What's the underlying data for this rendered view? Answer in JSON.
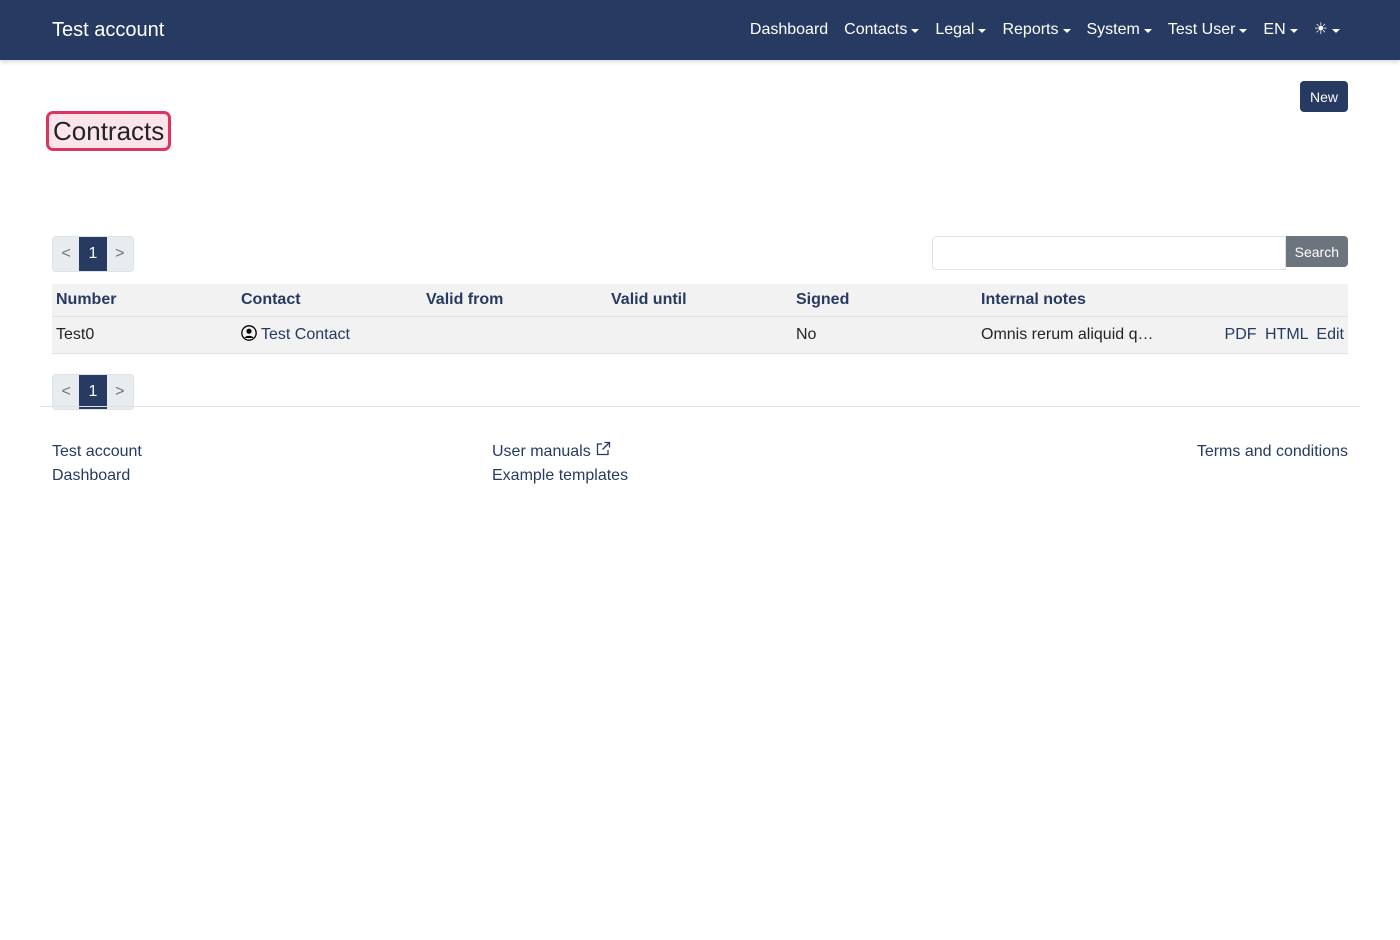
{
  "navbar": {
    "brand": "Test account",
    "items": [
      {
        "label": "Dashboard"
      },
      {
        "label": "Contacts"
      },
      {
        "label": "Legal"
      },
      {
        "label": "Reports"
      },
      {
        "label": "System"
      },
      {
        "label": "Test User"
      },
      {
        "label": "EN"
      }
    ],
    "theme_icon": "sun-icon",
    "background": "#263a62"
  },
  "page": {
    "title": "Contracts",
    "new_button": "New",
    "title_highlight_border": "#dc3560"
  },
  "pager": {
    "prev": "<",
    "current": "1",
    "next": ">"
  },
  "search": {
    "value": "",
    "placeholder": "",
    "button": "Search"
  },
  "table": {
    "headers": [
      "Number",
      "Contact",
      "Valid from",
      "Valid until",
      "Signed",
      "Internal notes"
    ],
    "rows": [
      {
        "number": "Test0",
        "contact": "Test Contact",
        "valid_from": "",
        "valid_until": "",
        "signed": "No",
        "notes": "Omnis rerum aliquid q…",
        "actions": {
          "pdf": "PDF",
          "html": "HTML",
          "edit": "Edit"
        }
      }
    ]
  },
  "footer": {
    "left": [
      "Test account",
      "Dashboard"
    ],
    "middle": [
      "User manuals",
      "Example templates"
    ],
    "right": [
      "Terms and conditions"
    ]
  }
}
